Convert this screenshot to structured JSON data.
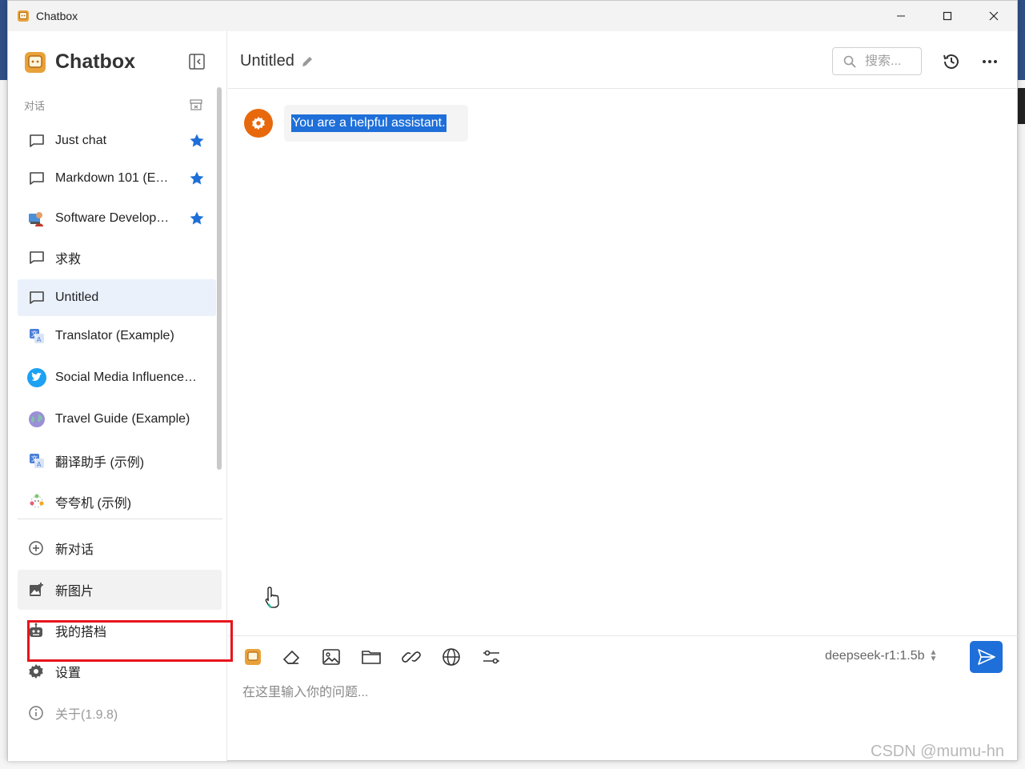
{
  "window": {
    "title": "Chatbox"
  },
  "sidebar": {
    "brand": "Chatbox",
    "section_label": "对话",
    "conversations": [
      {
        "label": "Just chat",
        "icon": "chat-bubble-icon",
        "starred": true
      },
      {
        "label": "Markdown 101 (E…",
        "icon": "chat-bubble-icon",
        "starred": true
      },
      {
        "label": "Software Develop…",
        "icon": "developer-avatar-icon",
        "starred": true
      },
      {
        "label": "求救",
        "icon": "chat-bubble-icon",
        "starred": false
      },
      {
        "label": "Untitled",
        "icon": "chat-bubble-icon",
        "starred": false,
        "active": true
      },
      {
        "label": "Translator (Example)",
        "icon": "translator-avatar-icon",
        "starred": false
      },
      {
        "label": "Social Media Influence…",
        "icon": "twitter-avatar-icon",
        "starred": false
      },
      {
        "label": "Travel Guide (Example)",
        "icon": "globe-avatar-icon",
        "starred": false
      },
      {
        "label": "翻译助手 (示例)",
        "icon": "translator-avatar-icon",
        "starred": false
      },
      {
        "label": "夸夸机 (示例)",
        "icon": "flower-avatar-icon",
        "starred": false
      }
    ],
    "menu": {
      "new_chat": "新对话",
      "new_image": "新图片",
      "my_partners": "我的搭档",
      "settings": "设置",
      "about": "关于(1.9.8)"
    }
  },
  "main": {
    "title": "Untitled",
    "search_placeholder": "搜索...",
    "system_message": "You are a helpful assistant.",
    "model": "deepseek-r1:1.5b",
    "input_placeholder": "在这里输入你的问题..."
  },
  "watermark": "CSDN @mumu-hn",
  "colors": {
    "accent": "#1e6fd9",
    "star": "#1e6fd9",
    "avatar": "#e8680c",
    "highlight_box": "#e8141c"
  }
}
